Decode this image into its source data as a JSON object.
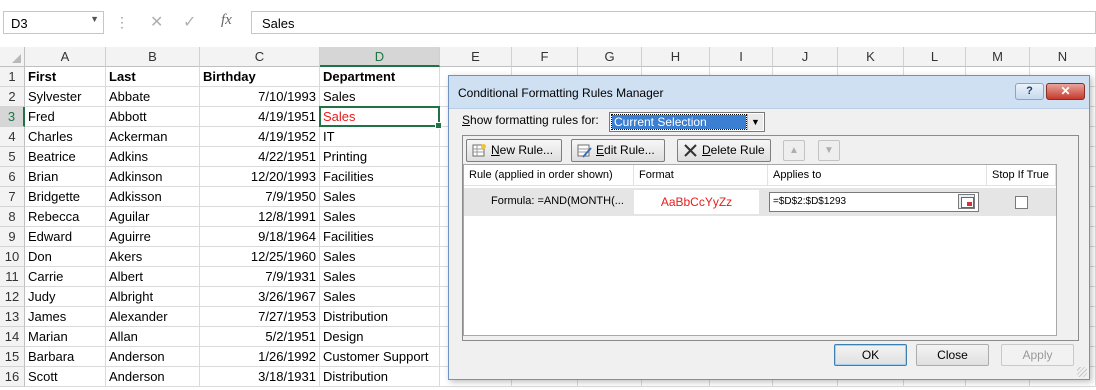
{
  "formula_bar": {
    "name_box": "D3",
    "formula": "Sales",
    "cancel_icon": "close-icon",
    "enter_icon": "check-icon",
    "fx_label": "fx"
  },
  "sheet": {
    "columns": [
      "A",
      "B",
      "C",
      "D",
      "E",
      "F",
      "G",
      "H",
      "I",
      "J",
      "K",
      "L",
      "M",
      "N"
    ],
    "selected_column": "D",
    "row_numbers": [
      "1",
      "2",
      "3",
      "4",
      "5",
      "6",
      "7",
      "8",
      "9",
      "10",
      "11",
      "12",
      "13",
      "14",
      "15",
      "16"
    ],
    "selected_row": "3",
    "header": [
      "First",
      "Last",
      "Birthday",
      "Department"
    ],
    "rows": [
      [
        "Sylvester",
        "Abbate",
        "7/10/1993",
        "Sales"
      ],
      [
        "Fred",
        "Abbott",
        "4/19/1951",
        "Sales"
      ],
      [
        "Charles",
        "Ackerman",
        "4/19/1952",
        "IT"
      ],
      [
        "Beatrice",
        "Adkins",
        "4/22/1951",
        "Printing"
      ],
      [
        "Brian",
        "Adkinson",
        "12/20/1993",
        "Facilities"
      ],
      [
        "Bridgette",
        "Adkisson",
        "7/9/1950",
        "Sales"
      ],
      [
        "Rebecca",
        "Aguilar",
        "12/8/1991",
        "Sales"
      ],
      [
        "Edward",
        "Aguirre",
        "9/18/1964",
        "Facilities"
      ],
      [
        "Don",
        "Akers",
        "12/25/1960",
        "Sales"
      ],
      [
        "Carrie",
        "Albert",
        "7/9/1931",
        "Sales"
      ],
      [
        "Judy",
        "Albright",
        "3/26/1967",
        "Sales"
      ],
      [
        "James",
        "Alexander",
        "7/27/1953",
        "Distribution"
      ],
      [
        "Marian",
        "Allan",
        "5/2/1951",
        "Design"
      ],
      [
        "Barbara",
        "Anderson",
        "1/26/1992",
        "Customer Support"
      ],
      [
        "Scott",
        "Anderson",
        "3/18/1931",
        "Distribution"
      ]
    ],
    "highlight_color": "#e81c1c",
    "accent_color": "#217346"
  },
  "dialog": {
    "title": "Conditional Formatting Rules Manager",
    "help_label": "?",
    "close_label": "✕",
    "show_rules_label_pre": "S",
    "show_rules_label_rest": "how formatting rules for:",
    "show_rules_value": "Current Selection",
    "toolbar": {
      "new_rule_u": "N",
      "new_rule_rest": "ew Rule...",
      "edit_rule_u": "E",
      "edit_rule_rest": "dit Rule...",
      "delete_rule_u": "D",
      "delete_rule_rest": "elete Rule",
      "move_up_icon": "arrow-up-icon",
      "move_down_icon": "arrow-down-icon"
    },
    "columns": {
      "rule": "Rule (applied in order shown)",
      "format": "Format",
      "applies_to": "Applies to",
      "stop_if_true": "Stop If True"
    },
    "rule": {
      "name": "Formula: =AND(MONTH(...",
      "format_preview": "AaBbCcYyZz",
      "applies_to": "=$D$2:$D$1293",
      "stop_if_true": false
    },
    "buttons": {
      "ok": "OK",
      "close": "Close",
      "apply": "Apply"
    }
  }
}
